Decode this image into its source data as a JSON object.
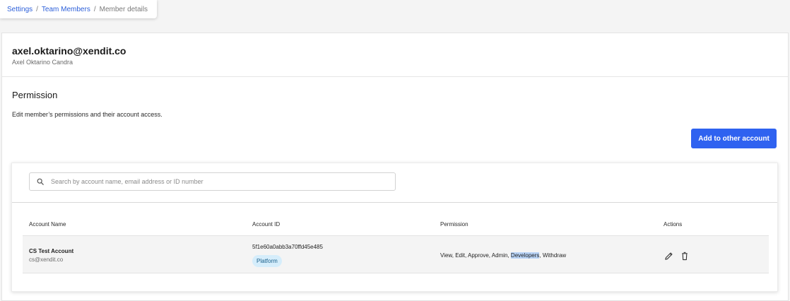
{
  "breadcrumb": {
    "items": [
      "Settings",
      "Team Members",
      "Member details"
    ],
    "separator": "/"
  },
  "member": {
    "email": "axel.oktarino@xendit.co",
    "name": "Axel Oktarino Candra"
  },
  "permission": {
    "title": "Permission",
    "description": "Edit member’s permissions and their account access.",
    "add_button_label": "Add to other account"
  },
  "search": {
    "placeholder": "Search by account name, email address or ID number",
    "value": ""
  },
  "table": {
    "headers": {
      "account_name": "Account Name",
      "account_id": "Account ID",
      "permission": "Permission",
      "actions": "Actions"
    },
    "rows": [
      {
        "account_name": "CS Test Account",
        "account_email": "cs@xendit.co",
        "account_id": "5f1e60a0abb3a70ffd45e485",
        "badge": "Platform",
        "permissions_before": "View, Edit, Approve, Admin, ",
        "permissions_highlight": "Developers",
        "permissions_after": ", Withdraw"
      }
    ]
  },
  "colors": {
    "primary_button": "#2f62f0",
    "link": "#2c5fd9",
    "badge_bg": "#d5edfb",
    "selection_highlight": "#b8d3f6"
  },
  "icons": {
    "search": "search-icon",
    "edit": "pencil-icon",
    "delete": "trash-icon"
  }
}
